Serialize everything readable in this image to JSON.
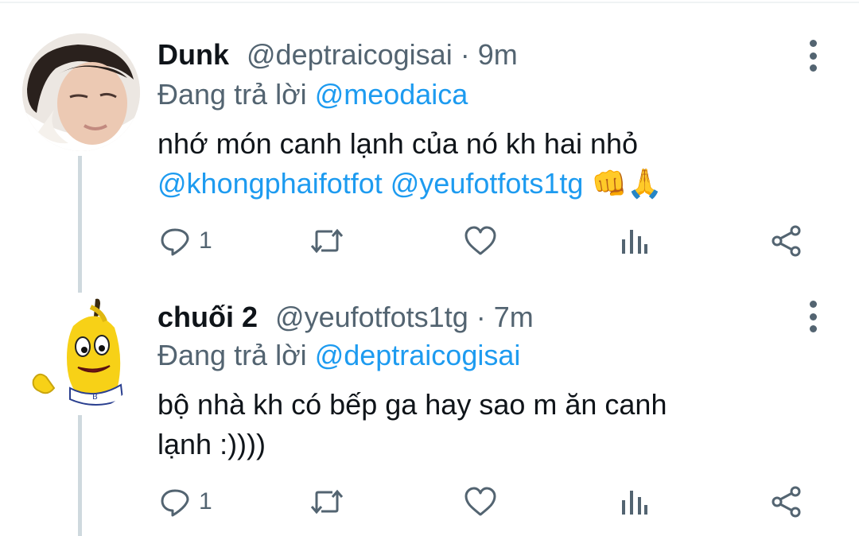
{
  "tweets": [
    {
      "name": "Dunk",
      "handle": "@deptraicogisai",
      "separator": " · ",
      "time": "9m",
      "reply_prefix": "Đang trả lời ",
      "reply_to": "@meodaica",
      "text_line1": "nhớ món canh lạnh của nó kh hai nhỏ",
      "mention1": "@khongphaifotfot",
      "mention2": "@yeufotfots1tg",
      "emoji": "👊🙏",
      "reply_count": "1",
      "icons": [
        "reply-icon",
        "retweet-icon",
        "like-icon",
        "analytics-icon",
        "share-icon",
        "more-icon"
      ]
    },
    {
      "name": "chuối 2",
      "handle": "@yeufotfots1tg",
      "separator": " · ",
      "time": "7m",
      "reply_prefix": "Đang trả lời ",
      "reply_to": "@deptraicogisai",
      "text_line1": "bộ nhà kh có bếp ga hay sao m ăn canh",
      "text_line2": "lạnh :))))",
      "reply_count": "1",
      "icons": [
        "reply-icon",
        "retweet-icon",
        "like-icon",
        "analytics-icon",
        "share-icon",
        "more-icon"
      ]
    }
  ],
  "colors": {
    "accent": "#1d9bf0",
    "secondary_text": "#536471",
    "primary_text": "#0f1419",
    "thread_line": "#cfd9de"
  }
}
